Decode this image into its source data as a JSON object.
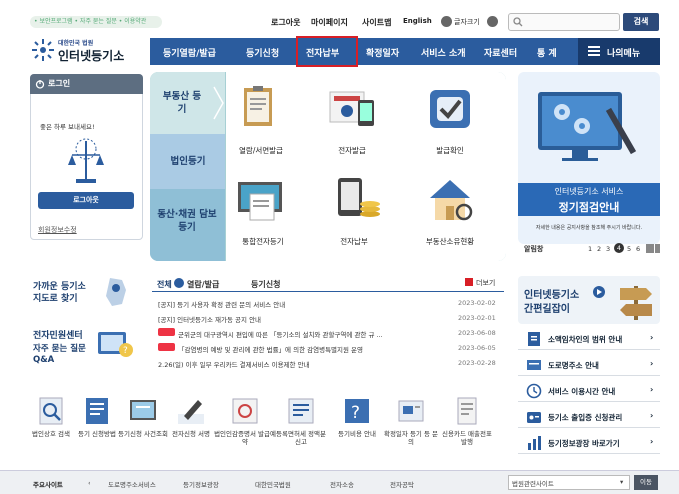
{
  "top": {
    "breadcrumb": "• 보안프로그램 • 자주 묻는 질문 • 이용약관",
    "links": [
      "로그아웃",
      "마이페이지",
      "사이트맵",
      "English"
    ],
    "font_size": "글자크기",
    "search_btn": "검색"
  },
  "logo": {
    "sub": "대한민국 법원",
    "main": "인터넷등기소"
  },
  "nav": [
    "등기열람/발급",
    "등기신청",
    "전자납부",
    "확정일자",
    "서비스 소개",
    "자료센터",
    "통 계"
  ],
  "nav_menu": "나의메뉴",
  "login": {
    "title": "로그인",
    "greeting": "좋은 하루 보내세요!",
    "logout": "로그아웃",
    "info": "회원정보수정"
  },
  "tiles": {
    "cat_realestate": "부동산 등기",
    "cat_corp": "법인등기",
    "cat_movable": "동산·채권 담보 등기",
    "items": [
      "열람/서면발급",
      "전자발급",
      "발급확인",
      "통합전자등기",
      "전자납부",
      "부동산소유현황"
    ]
  },
  "right_ad": {
    "title": "인터넷등기소 서비스",
    "subtitle": "정기점검안내",
    "note": "자세한 내용은 공지사항을 참조해 주시기 바랍니다.",
    "popup_label": "알림창",
    "pages": [
      "1",
      "2",
      "3",
      "4",
      "5",
      "6"
    ]
  },
  "help": {
    "title_1": "가까운 등기소",
    "title_2": "지도로 찾기",
    "center_1": "전자민원센터",
    "center_2": "자주 묻는 질문 Q&A"
  },
  "news": {
    "tabs": [
      "전체",
      "열람/발급",
      "등기신청"
    ],
    "more": "더보기",
    "items": [
      {
        "text": "[공지] 등기 사용자 확정 관련 문의 서비스 안내",
        "date": "2023-02-02"
      },
      {
        "text": "[공지] 인터넷등기소 재가동 공지 안내",
        "date": "2023-02-01"
      },
      {
        "text": "군위군의 대구광역시 편입에 따른 「등기소의 설치와 관할구역에 관한 규 ...",
        "date": "2023-06-08"
      },
      {
        "text": "「감염병의 예방 및 관리에 관한 법률」에 의한 감염병특별지원 운영",
        "date": "2023-06-05"
      },
      {
        "text": "2.26(일) 이후 일부 우리카드 결제서비스 이용제한 안내",
        "date": "2023-02-28"
      }
    ]
  },
  "right_links": {
    "quick_title_1": "인터넷등기소",
    "quick_title_2": "간편길잡이",
    "items": [
      "소액임차인의 범위 안내",
      "도로명주소 안내",
      "서비스 이용시간 안내",
      "등기소 출입증 신청관리",
      "등기정보광장 바로가기"
    ]
  },
  "bottom_icons": [
    "법인상호 검색",
    "등기 신청방법",
    "등기신청 사건조회",
    "전자신청 서명",
    "법인인감증명서 발급예약",
    "등록면허세 정액분 신고",
    "등기비용 안내",
    "확정일자 등기 등 문의",
    "신용카드 매출전표 발행"
  ],
  "footer": {
    "label": "주요사이트",
    "links": [
      "도로명주소서비스",
      "등기정보광장",
      "대한민국법원",
      "전자소송",
      "전자공탁"
    ],
    "select": "법원관련사이트",
    "go": "이동"
  },
  "colors": {
    "nav": "#2b5c9e",
    "highlight": "#d81f26",
    "teal": "#a7d0d4"
  }
}
